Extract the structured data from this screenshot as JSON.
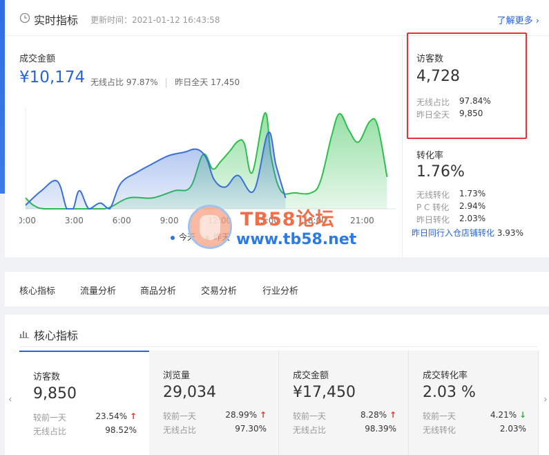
{
  "realtime": {
    "title": "实时指标",
    "update_time": "更新时间：2021-01-12 16:43:58",
    "more_link": "了解更多 ›",
    "gmv": {
      "label": "成交金额",
      "value": "¥10,174",
      "wireless_label": "无线占比",
      "wireless_value": "97.87%",
      "yesterday_label": "昨日全天",
      "yesterday_value": "17,450"
    },
    "visitors": {
      "label": "访客数",
      "value": "4,728",
      "wireless_label": "无线占比",
      "wireless_value": "97.84%",
      "yesterday_label": "昨日全天",
      "yesterday_value": "9,850"
    },
    "conversion": {
      "label": "转化率",
      "value": "1.76%",
      "wireless_label": "无线转化",
      "wireless_value": "1.73%",
      "pc_label": "P C 转化",
      "pc_value": "2.94%",
      "yesterday_label": "昨日转化",
      "yesterday_value": "2.03%",
      "compare_label": "昨日同行入仓店铺转化",
      "compare_value": "3.93%"
    },
    "legend": {
      "today": "今天",
      "yesterday": "昨天"
    }
  },
  "chart_data": {
    "type": "area",
    "x": [
      "0:00",
      "3:00",
      "6:00",
      "9:00",
      "12:00",
      "15:00",
      "18:00",
      "21:00"
    ],
    "x_range": [
      0,
      24
    ],
    "series": [
      {
        "name": "今天",
        "color": "#3a6fd8",
        "points": [
          [
            0,
            0.5
          ],
          [
            1,
            2.5
          ],
          [
            2,
            3.8
          ],
          [
            2.6,
            0
          ],
          [
            3,
            0
          ],
          [
            3.4,
            2.5
          ],
          [
            4,
            0
          ],
          [
            4.7,
            0.8
          ],
          [
            5.3,
            0
          ],
          [
            6,
            3.5
          ],
          [
            7,
            5
          ],
          [
            8,
            6.2
          ],
          [
            9,
            7.3
          ],
          [
            10,
            7.8
          ],
          [
            10.8,
            8.2
          ],
          [
            11.4,
            7
          ],
          [
            11.9,
            4
          ],
          [
            12.6,
            3
          ],
          [
            13.4,
            4.6
          ],
          [
            14.4,
            2.5
          ],
          [
            15.3,
            10.5
          ],
          [
            15.8,
            6
          ],
          [
            16.4,
            1.5
          ]
        ]
      },
      {
        "name": "昨天",
        "color": "#2cbf4a",
        "points": [
          [
            0,
            1.5
          ],
          [
            0.5,
            0.5
          ],
          [
            1.2,
            0
          ],
          [
            3,
            0
          ],
          [
            5,
            0
          ],
          [
            6.5,
            1.5
          ],
          [
            8,
            1.5
          ],
          [
            9.4,
            2.5
          ],
          [
            10.4,
            3
          ],
          [
            11.2,
            7.5
          ],
          [
            11.8,
            5.5
          ],
          [
            12.3,
            6.5
          ],
          [
            12.9,
            8
          ],
          [
            13.4,
            9.3
          ],
          [
            13.8,
            9
          ],
          [
            14.3,
            5
          ],
          [
            15.1,
            13.2
          ],
          [
            15.5,
            7
          ],
          [
            16.1,
            2.5
          ],
          [
            17,
            2.2
          ],
          [
            18,
            2.2
          ],
          [
            18.6,
            3.8
          ],
          [
            19.3,
            10
          ],
          [
            19.8,
            13.1
          ],
          [
            20.4,
            10.8
          ],
          [
            21,
            9.2
          ],
          [
            21.7,
            12
          ],
          [
            22.2,
            11.5
          ],
          [
            22.8,
            4.4
          ]
        ]
      }
    ]
  },
  "tabs": [
    "核心指标",
    "流量分析",
    "商品分析",
    "交易分析",
    "行业分析"
  ],
  "core": {
    "title": "核心指标",
    "cards": [
      {
        "name": "访客数",
        "value": "9,850",
        "cmp_label": "较前一天",
        "cmp_value": "23.54%",
        "cmp_dir": "↑",
        "sub_label": "无线占比",
        "sub_value": "98.52%"
      },
      {
        "name": "浏览量",
        "value": "29,034",
        "cmp_label": "较前一天",
        "cmp_value": "28.99%",
        "cmp_dir": "↑",
        "sub_label": "无线占比",
        "sub_value": "97.30%"
      },
      {
        "name": "成交金额",
        "value": "¥17,450",
        "cmp_label": "较前一天",
        "cmp_value": "8.28%",
        "cmp_dir": "↑",
        "sub_label": "无线占比",
        "sub_value": "98.39%"
      },
      {
        "name": "成交转化率",
        "value": "2.03 %",
        "cmp_label": "较前一天",
        "cmp_value": "4.21%",
        "cmp_dir": "↓",
        "sub_label": "无线转化",
        "sub_value": "2.03%"
      }
    ]
  },
  "watermark": {
    "title": "TB58论坛",
    "url": "www.tb58.net"
  },
  "nav": {
    "prev": "‹",
    "next": "›"
  }
}
